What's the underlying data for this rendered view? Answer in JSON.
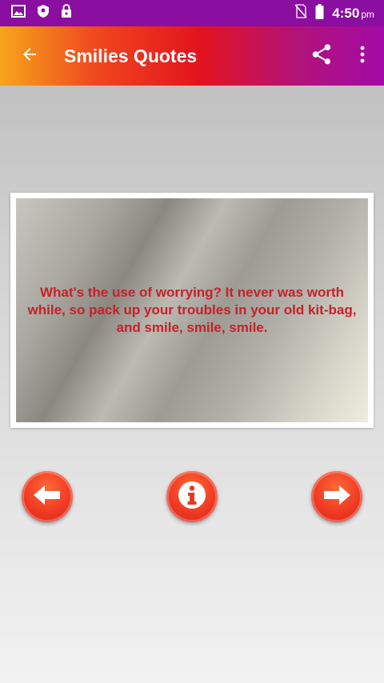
{
  "status_bar": {
    "time": "4:50",
    "ampm": "pm",
    "icons": [
      "image-icon",
      "shield-icon",
      "lock-icon",
      "no-sim-icon",
      "battery-icon"
    ]
  },
  "app_bar": {
    "title": "Smilies Quotes",
    "back_icon": "arrow-left-icon",
    "share_icon": "share-icon",
    "more_icon": "more-vert-icon"
  },
  "quote": {
    "text": "What's the use of worrying? It never was worth while, so pack up your troubles in your old kit-bag, and smile, smile, smile."
  },
  "nav": {
    "prev_icon": "arrow-left-icon",
    "info_icon": "info-icon",
    "next_icon": "arrow-right-icon"
  },
  "colors": {
    "status_bar": "#8a0ea0",
    "quote_text": "#c8202a",
    "button": "#f03a22"
  }
}
